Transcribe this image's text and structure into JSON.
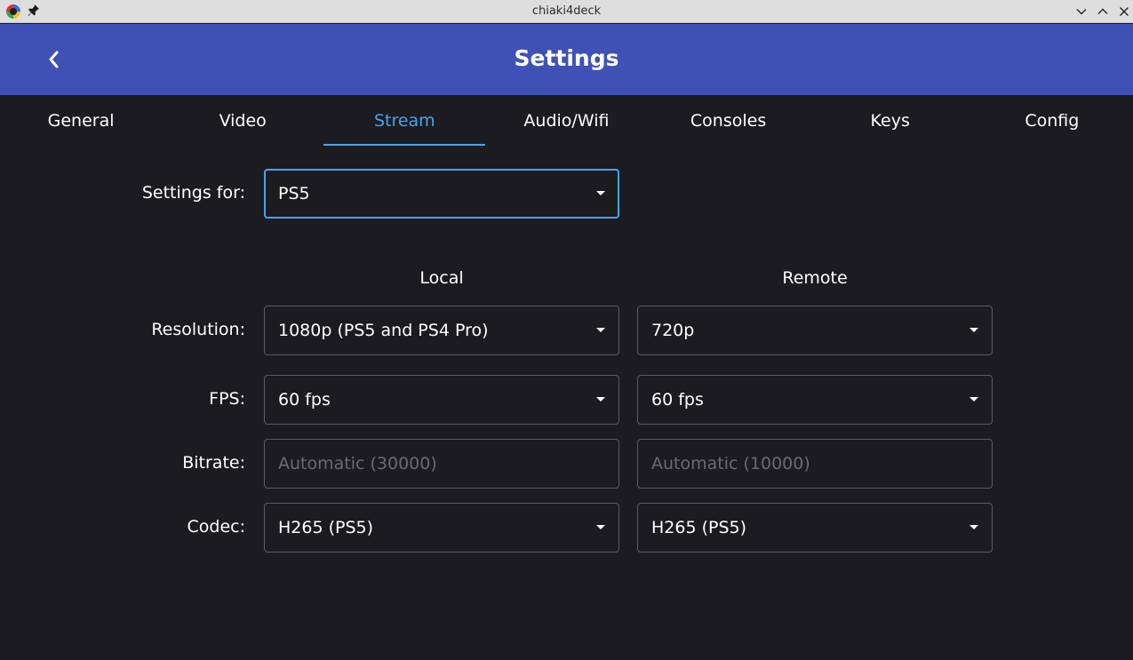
{
  "window": {
    "title": "chiaki4deck",
    "icons": [
      "app-icon",
      "pin-icon",
      "chevron-down-icon",
      "chevron-up-icon",
      "close-icon"
    ]
  },
  "header": {
    "title": "Settings",
    "back_icon": "chevron-left-icon",
    "color": "#3f51b5"
  },
  "tabs": [
    {
      "label": "General",
      "active": false
    },
    {
      "label": "Video",
      "active": false
    },
    {
      "label": "Stream",
      "active": true
    },
    {
      "label": "Audio/Wifi",
      "active": false
    },
    {
      "label": "Consoles",
      "active": false
    },
    {
      "label": "Keys",
      "active": false
    },
    {
      "label": "Config",
      "active": false
    }
  ],
  "accent_color": "#42a5f5",
  "form": {
    "settings_for": {
      "label": "Settings for:",
      "value": "PS5"
    },
    "columns": {
      "local": "Local",
      "remote": "Remote"
    },
    "resolution": {
      "label": "Resolution:",
      "local": "1080p (PS5 and PS4 Pro)",
      "remote": "720p"
    },
    "fps": {
      "label": "FPS:",
      "local": "60 fps",
      "remote": "60 fps"
    },
    "bitrate": {
      "label": "Bitrate:",
      "local_placeholder": "Automatic (30000)",
      "remote_placeholder": "Automatic (10000)"
    },
    "codec": {
      "label": "Codec:",
      "local": "H265 (PS5)",
      "remote": "H265 (PS5)"
    }
  }
}
